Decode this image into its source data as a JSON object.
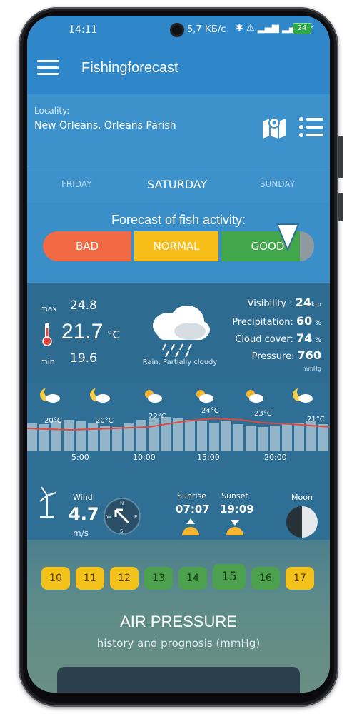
{
  "status": {
    "time": "14:11",
    "net": "5,7 КБ/с",
    "battery": "24"
  },
  "app": {
    "title": "Fishingforecast"
  },
  "locality": {
    "label": "Locality:",
    "value": "New Orleans, Orleans Parish"
  },
  "days": {
    "prev": "FRIDAY",
    "current": "SATURDAY",
    "next": "SUNDAY"
  },
  "forecast": {
    "label": "Forecast of fish activity:",
    "bad": "BAD",
    "normal": "NORMAL",
    "good": "GOOD",
    "level": "GOOD"
  },
  "weather": {
    "max_label": "max",
    "max": "24.8",
    "current": "21.7",
    "unit": "°C",
    "min_label": "min",
    "min": "19.6",
    "condition": "Rain, Partially cloudy",
    "visibility_label": "Visibility :",
    "visibility": "24",
    "visibility_unit": "km",
    "precip_label": "Precipitation:",
    "precip": "60",
    "precip_unit": "%",
    "cloud_label": "Cloud cover:",
    "cloud": "74",
    "cloud_unit": "%",
    "pressure_label": "Pressure:",
    "pressure": "760",
    "pressure_unit": "mmHg"
  },
  "hourly": {
    "temps": [
      "20°C",
      "20°C",
      "22°C",
      "24°C",
      "23°C",
      "21°C"
    ],
    "times": [
      "5:00",
      "10:00",
      "15:00",
      "20:00"
    ],
    "icons": [
      "moon-cloud-icon",
      "moon-cloud-icon",
      "sun-cloud-icon",
      "sun-cloud-icon",
      "sun-cloud-icon",
      "moon-cloud-icon"
    ]
  },
  "wind": {
    "label": "Wind",
    "value": "4.7",
    "unit": "m/s",
    "direction": "NW"
  },
  "sun": {
    "sunrise_label": "Sunrise",
    "sunrise": "07:07",
    "sunset_label": "Sunset",
    "sunset": "19:09"
  },
  "moon": {
    "label": "Moon"
  },
  "calendar": {
    "days": [
      {
        "n": "10",
        "c": "y"
      },
      {
        "n": "11",
        "c": "y"
      },
      {
        "n": "12",
        "c": "y"
      },
      {
        "n": "13",
        "c": "g"
      },
      {
        "n": "14",
        "c": "g"
      },
      {
        "n": "15",
        "c": "g",
        "active": true
      },
      {
        "n": "16",
        "c": "g"
      },
      {
        "n": "17",
        "c": "y"
      }
    ]
  },
  "air": {
    "title": "AIR PRESSURE",
    "subtitle": "history and prognosis (mmHg)"
  },
  "colors": {
    "bad": "#f26a44",
    "normal": "#f7bd18",
    "good": "#41a74a",
    "header": "#2f86c8"
  }
}
